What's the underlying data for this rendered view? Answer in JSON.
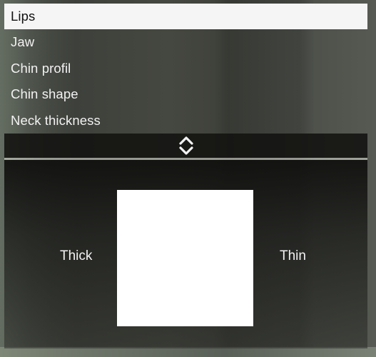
{
  "menu": {
    "items": [
      {
        "label": "Lips",
        "selected": true
      },
      {
        "label": "Jaw",
        "selected": false
      },
      {
        "label": "Chin profil",
        "selected": false
      },
      {
        "label": "Chin shape",
        "selected": false
      },
      {
        "label": "Neck thickness",
        "selected": false
      }
    ],
    "scroll_icon": "up-down-chevrons-icon"
  },
  "grid": {
    "left_label": "Thick",
    "right_label": "Thin"
  },
  "colors": {
    "selected_bg": "#f5f5f5",
    "panel_bg": "#121210",
    "text": "#f2f2f2"
  }
}
